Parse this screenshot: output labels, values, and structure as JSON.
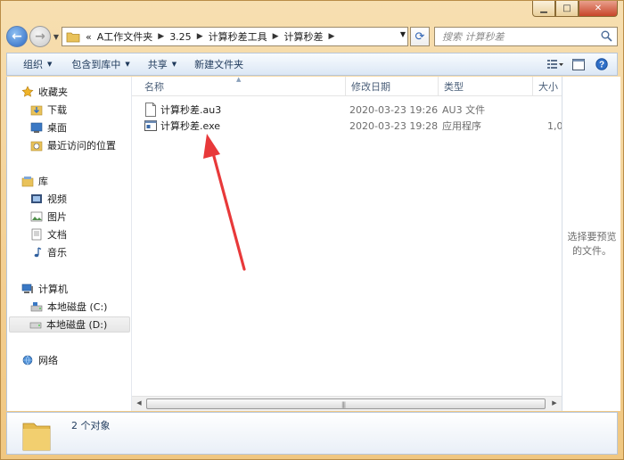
{
  "window": {
    "caption_min": "▁",
    "caption_max": "□",
    "caption_close": "✕"
  },
  "navbar": {
    "breadcrumbs": [
      "«",
      "A工作文件夹",
      "3.25",
      "计算秒差工具",
      "计算秒差"
    ],
    "search_placeholder": "搜索 计算秒差"
  },
  "toolbar": {
    "organize": "组织",
    "include_in_library": "包含到库中",
    "share": "共享",
    "new_folder": "新建文件夹"
  },
  "nav_pane": {
    "favorites": "收藏夹",
    "downloads": "下载",
    "desktop": "桌面",
    "recent": "最近访问的位置",
    "libraries": "库",
    "videos": "视频",
    "pictures": "图片",
    "documents": "文档",
    "music": "音乐",
    "computer": "计算机",
    "drive_c": "本地磁盘 (C:)",
    "drive_d": "本地磁盘 (D:)",
    "network": "网络"
  },
  "columns": {
    "name": "名称",
    "date": "修改日期",
    "type": "类型",
    "size": "大小"
  },
  "files": [
    {
      "name": "计算秒差.au3",
      "date": "2020-03-23 19:26",
      "type": "AU3 文件",
      "size": ""
    },
    {
      "name": "计算秒差.exe",
      "date": "2020-03-23 19:28",
      "type": "应用程序",
      "size": "1,0"
    }
  ],
  "preview": {
    "line1": "选择要预览",
    "line2": "的文件。"
  },
  "status": {
    "count": "2 个对象"
  },
  "colors": {
    "annotation_arrow": "#e8393a",
    "frame": "#f3cf92"
  }
}
